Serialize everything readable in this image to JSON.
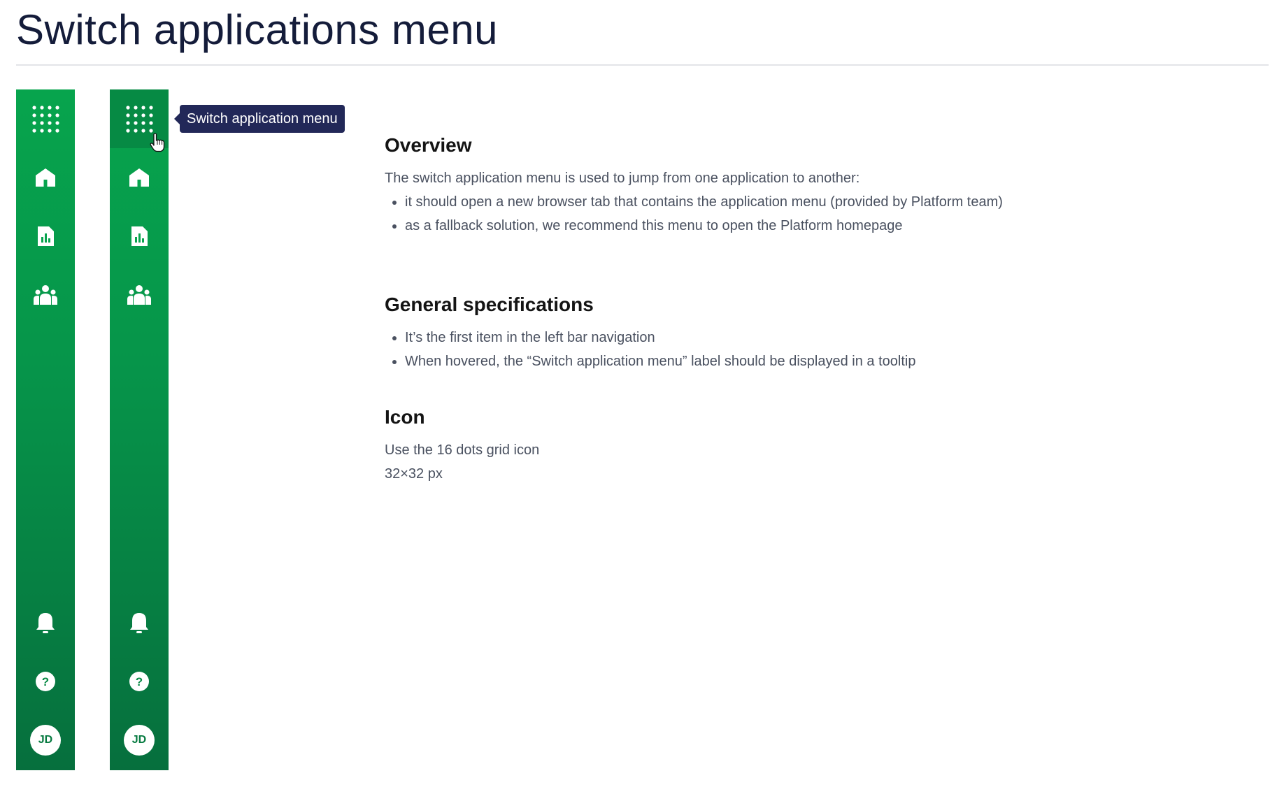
{
  "page": {
    "title": "Switch applications menu"
  },
  "sidebar": {
    "icons": [
      "grid-16-dots-icon",
      "home-icon",
      "report-icon",
      "team-icon",
      "bell-icon",
      "help-icon"
    ],
    "avatar_initials": "JD",
    "colors": {
      "gradient_top": "#07a44d",
      "gradient_bottom": "#066f3d",
      "hover": "#068a44"
    }
  },
  "tooltip": {
    "label": "Switch application menu",
    "color": "#222858"
  },
  "overview": {
    "heading": "Overview",
    "intro": "The switch application menu is used to jump from one application to another:",
    "bullets": [
      "it should open a new browser tab that contains the application menu (provided by Platform team)",
      "as a fallback solution, we recommend this menu to open the Platform homepage"
    ]
  },
  "general": {
    "heading": "General specifications",
    "bullets": [
      "It’s the first item in the left bar navigation",
      "When hovered, the “Switch application menu” label should be displayed in a tooltip"
    ]
  },
  "icon_section": {
    "heading": "Icon",
    "line1": "Use the 16 dots grid icon",
    "line2": "32×32 px"
  }
}
